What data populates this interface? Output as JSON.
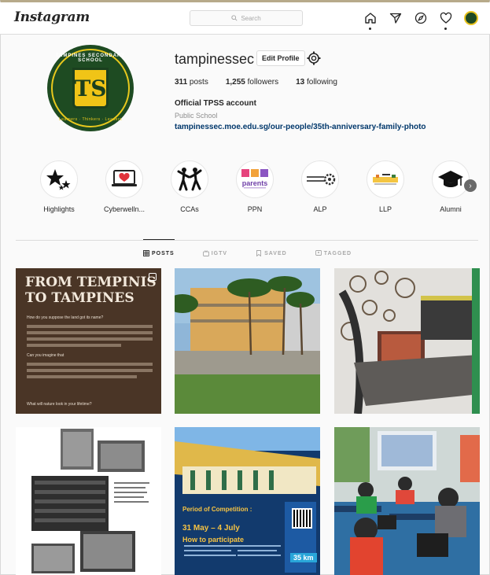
{
  "app": {
    "logo": "Instagram",
    "search_placeholder": "Search"
  },
  "nav_icons": [
    "home-icon",
    "direct-icon",
    "explore-icon",
    "activity-heart-icon",
    "profile-avatar"
  ],
  "profile": {
    "username": "tampinessec",
    "edit_label": "Edit Profile",
    "posts_count": "311",
    "posts_label": "posts",
    "followers_count": "1,255",
    "followers_label": "followers",
    "following_count": "13",
    "following_label": "following",
    "bio_name": "Official TPSS account",
    "category": "Public School",
    "link": "tampinessec.moe.edu.sg/our-people/35th-anniversary-family-photo",
    "logo_text_top": "TAMPINES SECONDARY SCHOOL",
    "logo_text_bottom": "Learners · Thinkers · Leaders",
    "logo_letters": "TS"
  },
  "highlights": [
    {
      "label": "Highlights",
      "icon": "stars-icon"
    },
    {
      "label": "Cyberwelln...",
      "icon": "laptop-heart-icon"
    },
    {
      "label": "CCAs",
      "icon": "dancers-icon"
    },
    {
      "label": "PPN",
      "icon": "ppn-parents-logo"
    },
    {
      "label": "ALP",
      "icon": "creative-engineering-logo"
    },
    {
      "label": "LLP",
      "icon": "llp-logo"
    },
    {
      "label": "Alumni",
      "icon": "graduation-cap-icon"
    }
  ],
  "tabs": [
    {
      "label": "POSTS",
      "icon": "grid-icon",
      "active": true
    },
    {
      "label": "IGTV",
      "icon": "igtv-icon",
      "active": false
    },
    {
      "label": "SAVED",
      "icon": "bookmark-icon",
      "active": false
    },
    {
      "label": "TAGGED",
      "icon": "tag-icon",
      "active": false
    }
  ],
  "posts": {
    "p1_title": "FROM TEMPINIS TO TAMPINES",
    "p1_q1": "How do you suppose the land got its name?",
    "p1_q2": "Can you imagine that",
    "p1_q3": "What will nature look in your lifetime?",
    "p5_headline": "Period of Competition :",
    "p5_dates": "31 May – 4 July",
    "p5_how": "How to participate",
    "p5_km": "35 km"
  },
  "colors": {
    "accent_link": "#00376b",
    "school_green": "#1e4b22",
    "school_gold": "#e8c81d"
  }
}
